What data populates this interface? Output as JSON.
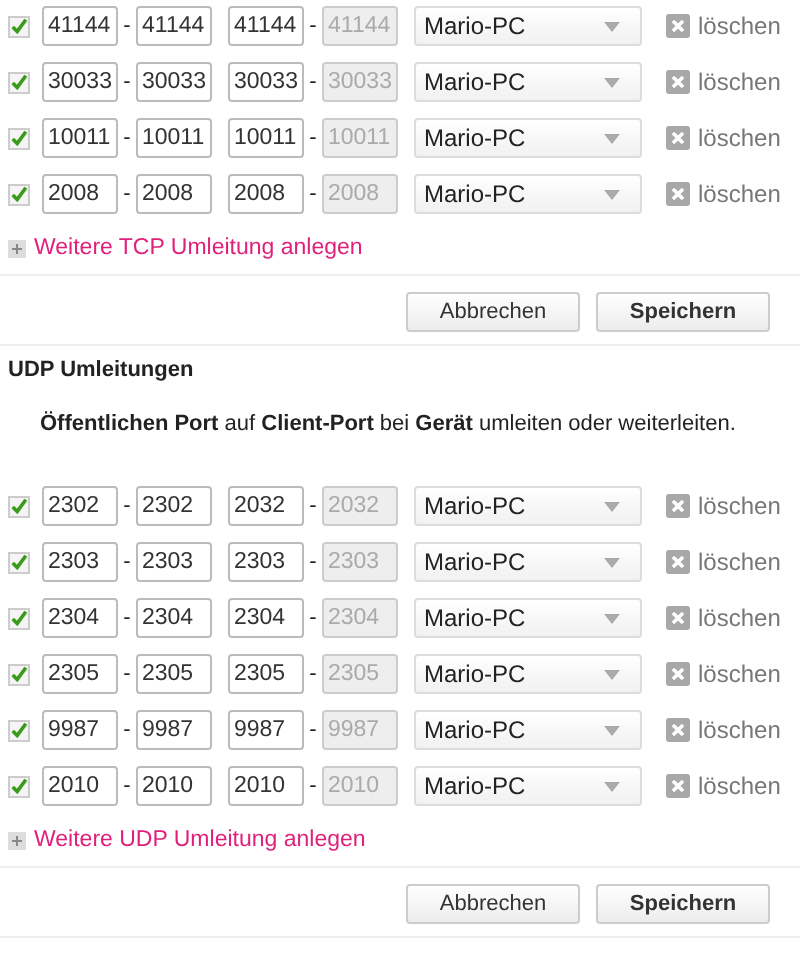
{
  "tcp": {
    "rows": [
      {
        "checked": true,
        "separator": "-",
        "ports": [
          {
            "value": "41144",
            "disabled": false
          },
          {
            "value": "41144",
            "disabled": false
          },
          {
            "value": "41144",
            "disabled": false
          },
          {
            "value": "41144",
            "disabled": true
          }
        ],
        "device": "Mario-PC",
        "delete": "löschen"
      },
      {
        "checked": true,
        "separator": "-",
        "ports": [
          {
            "value": "30033",
            "disabled": false
          },
          {
            "value": "30033",
            "disabled": false
          },
          {
            "value": "30033",
            "disabled": false
          },
          {
            "value": "30033",
            "disabled": true
          }
        ],
        "device": "Mario-PC",
        "delete": "löschen"
      },
      {
        "checked": true,
        "separator": "-",
        "ports": [
          {
            "value": "10011",
            "disabled": false
          },
          {
            "value": "10011",
            "disabled": false
          },
          {
            "value": "10011",
            "disabled": false
          },
          {
            "value": "10011",
            "disabled": true
          }
        ],
        "device": "Mario-PC",
        "delete": "löschen"
      },
      {
        "checked": true,
        "separator": "-",
        "ports": [
          {
            "value": "2008",
            "disabled": false
          },
          {
            "value": "2008",
            "disabled": false
          },
          {
            "value": "2008",
            "disabled": false
          },
          {
            "value": "2008",
            "disabled": true
          }
        ],
        "device": "Mario-PC",
        "delete": "löschen"
      }
    ],
    "add_link": "Weitere TCP Umleitung anlegen",
    "buttons": [
      "Abbrechen",
      "Speichern"
    ]
  },
  "udp": {
    "title": "UDP Umleitungen",
    "description": "**Öffentlichen Port** auf **Client-Port** bei **Gerät** umleiten oder weiterleiten.",
    "rows": [
      {
        "checked": true,
        "separator": "-",
        "ports": [
          {
            "value": "2302",
            "disabled": false
          },
          {
            "value": "2302",
            "disabled": false
          },
          {
            "value": "2032",
            "disabled": false
          },
          {
            "value": "2032",
            "disabled": true
          }
        ],
        "device": "Mario-PC",
        "delete": "löschen"
      },
      {
        "checked": true,
        "separator": "-",
        "ports": [
          {
            "value": "2303",
            "disabled": false
          },
          {
            "value": "2303",
            "disabled": false
          },
          {
            "value": "2303",
            "disabled": false
          },
          {
            "value": "2303",
            "disabled": true
          }
        ],
        "device": "Mario-PC",
        "delete": "löschen"
      },
      {
        "checked": true,
        "separator": "-",
        "ports": [
          {
            "value": "2304",
            "disabled": false
          },
          {
            "value": "2304",
            "disabled": false
          },
          {
            "value": "2304",
            "disabled": false
          },
          {
            "value": "2304",
            "disabled": true
          }
        ],
        "device": "Mario-PC",
        "delete": "löschen"
      },
      {
        "checked": true,
        "separator": "-",
        "ports": [
          {
            "value": "2305",
            "disabled": false
          },
          {
            "value": "2305",
            "disabled": false
          },
          {
            "value": "2305",
            "disabled": false
          },
          {
            "value": "2305",
            "disabled": true
          }
        ],
        "device": "Mario-PC",
        "delete": "löschen"
      },
      {
        "checked": true,
        "separator": "-",
        "ports": [
          {
            "value": "9987",
            "disabled": false
          },
          {
            "value": "9987",
            "disabled": false
          },
          {
            "value": "9987",
            "disabled": false
          },
          {
            "value": "9987",
            "disabled": true
          }
        ],
        "device": "Mario-PC",
        "delete": "löschen"
      },
      {
        "checked": true,
        "separator": "-",
        "ports": [
          {
            "value": "2010",
            "disabled": false
          },
          {
            "value": "2010",
            "disabled": false
          },
          {
            "value": "2010",
            "disabled": false
          },
          {
            "value": "2010",
            "disabled": true
          }
        ],
        "device": "Mario-PC",
        "delete": "löschen"
      }
    ],
    "add_link": "Weitere UDP Umleitung anlegen",
    "buttons": [
      "Abbrechen",
      "Speichern"
    ]
  }
}
